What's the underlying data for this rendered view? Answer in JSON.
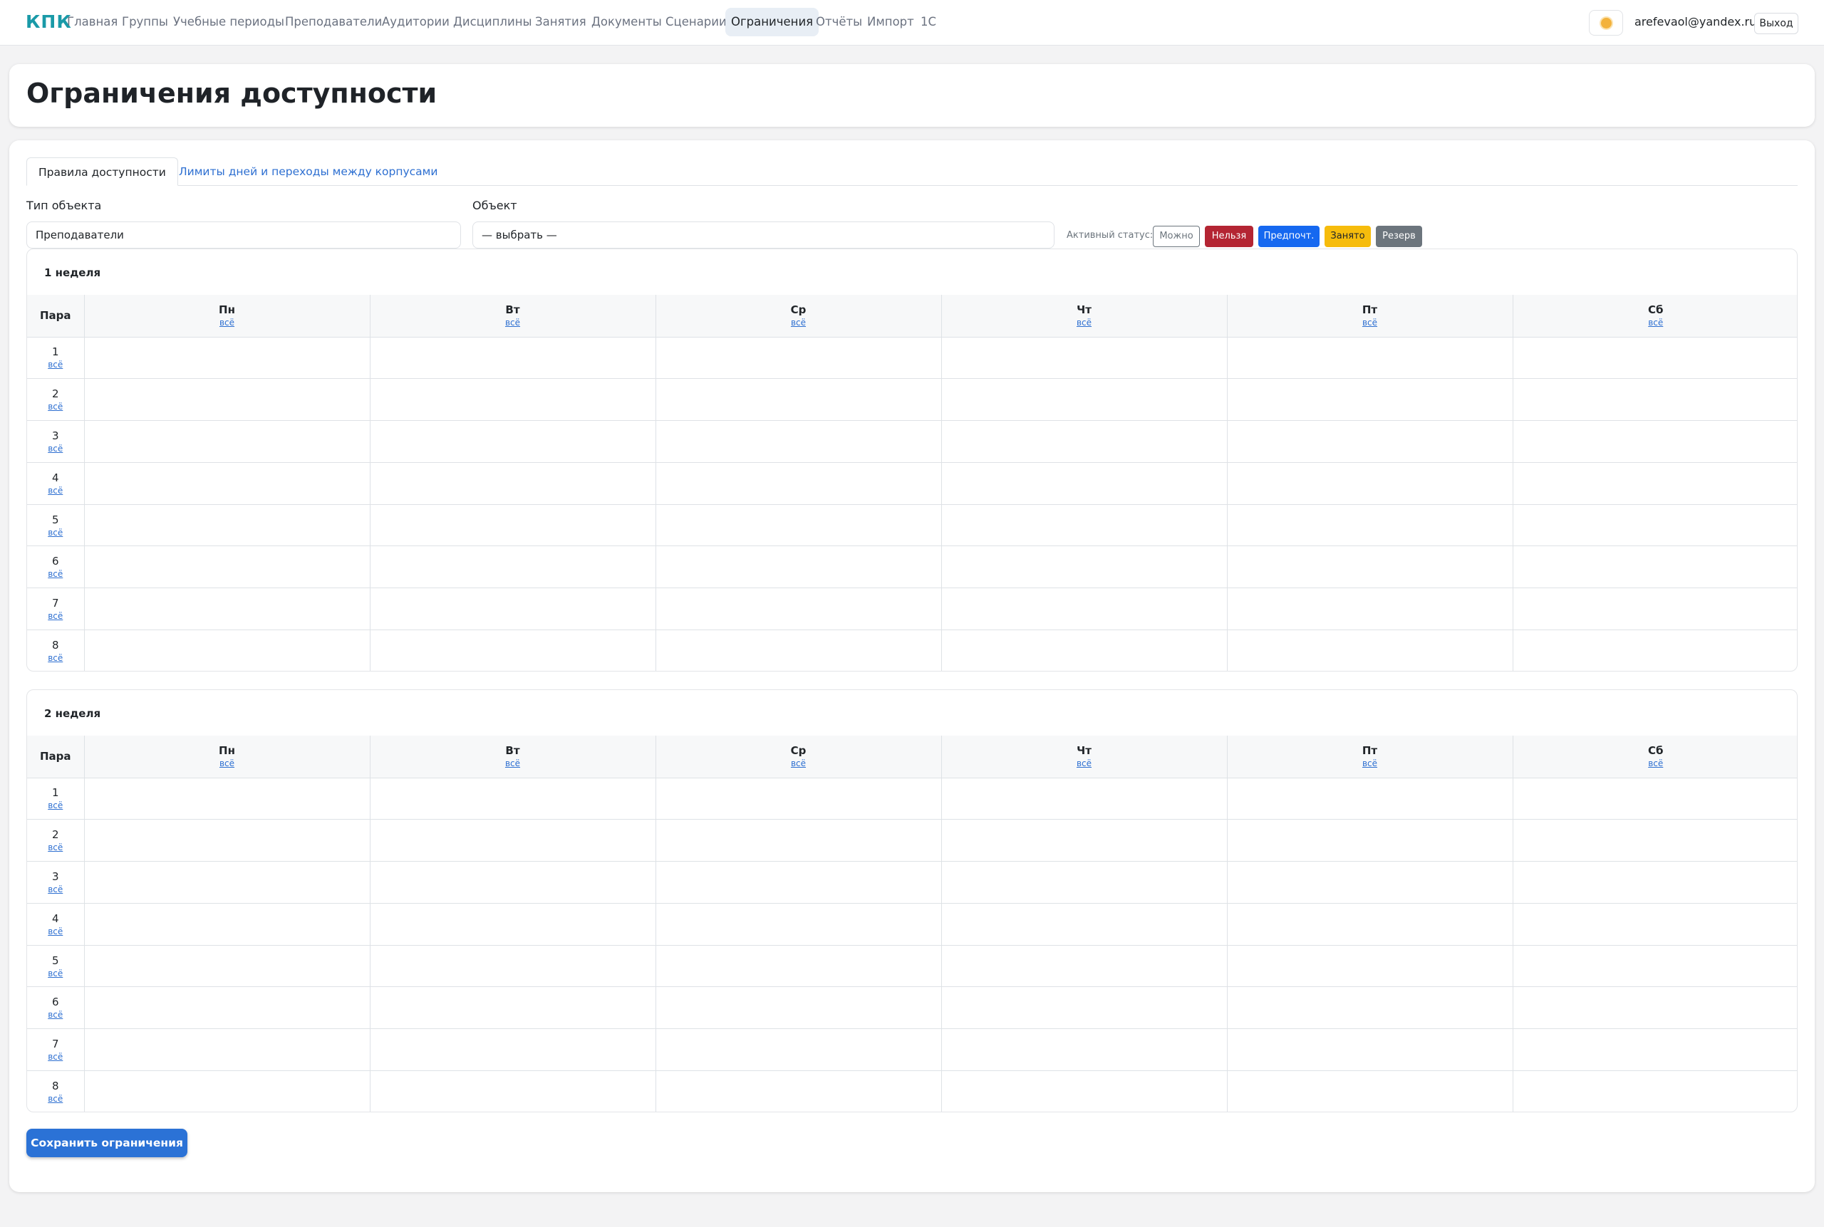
{
  "nav": {
    "brand": "КПК",
    "items": [
      "Главная",
      "Группы",
      "Учебные периоды",
      "Преподаватели",
      "Аудитории",
      "Дисциплины",
      "Занятия",
      "Документы",
      "Сценарии",
      "Ограничения",
      "Отчёты",
      "Импорт",
      "1С"
    ],
    "active": "Ограничения",
    "theme_icon": "sun-icon",
    "user_email": "arefevaol@yandex.ru",
    "logout": "Выход"
  },
  "page": {
    "title": "Ограничения доступности"
  },
  "tabs": [
    {
      "label": "Правила доступности",
      "active": true
    },
    {
      "label": "Лимиты дней и переходы между корпусами",
      "active": false
    }
  ],
  "filters": {
    "object_type_label": "Тип объекта",
    "object_type_value": "Преподаватели",
    "object_label": "Объект",
    "object_value": "— выбрать —"
  },
  "status": {
    "label": "Активный статус:",
    "buttons": [
      {
        "label": "Можно",
        "bg": "#ffffff",
        "fg": "#6c757d",
        "border": "#6c757d"
      },
      {
        "label": "Нельзя",
        "bg": "#b42533",
        "fg": "#ffffff",
        "border": "#b42533"
      },
      {
        "label": "Предпочт.",
        "bg": "#1668f0",
        "fg": "#ffffff",
        "border": "#1668f0"
      },
      {
        "label": "Занято",
        "bg": "#f6bc0c",
        "fg": "#212529",
        "border": "#f6bc0c"
      },
      {
        "label": "Резерв",
        "bg": "#6c757d",
        "fg": "#ffffff",
        "border": "#6c757d"
      }
    ]
  },
  "grid": {
    "para_header": "Пара",
    "all_label": "всё",
    "days": [
      "Пн",
      "Вт",
      "Ср",
      "Чт",
      "Пт",
      "Сб"
    ],
    "pairs": [
      "1",
      "2",
      "3",
      "4",
      "5",
      "6",
      "7",
      "8"
    ]
  },
  "weeks": [
    {
      "title": "1 неделя"
    },
    {
      "title": "2 неделя"
    }
  ],
  "save_button": "Сохранить ограничения",
  "colors": {
    "brand": "#1a9aa8",
    "link": "#2d6fd1",
    "primary": "#2b72d6"
  }
}
